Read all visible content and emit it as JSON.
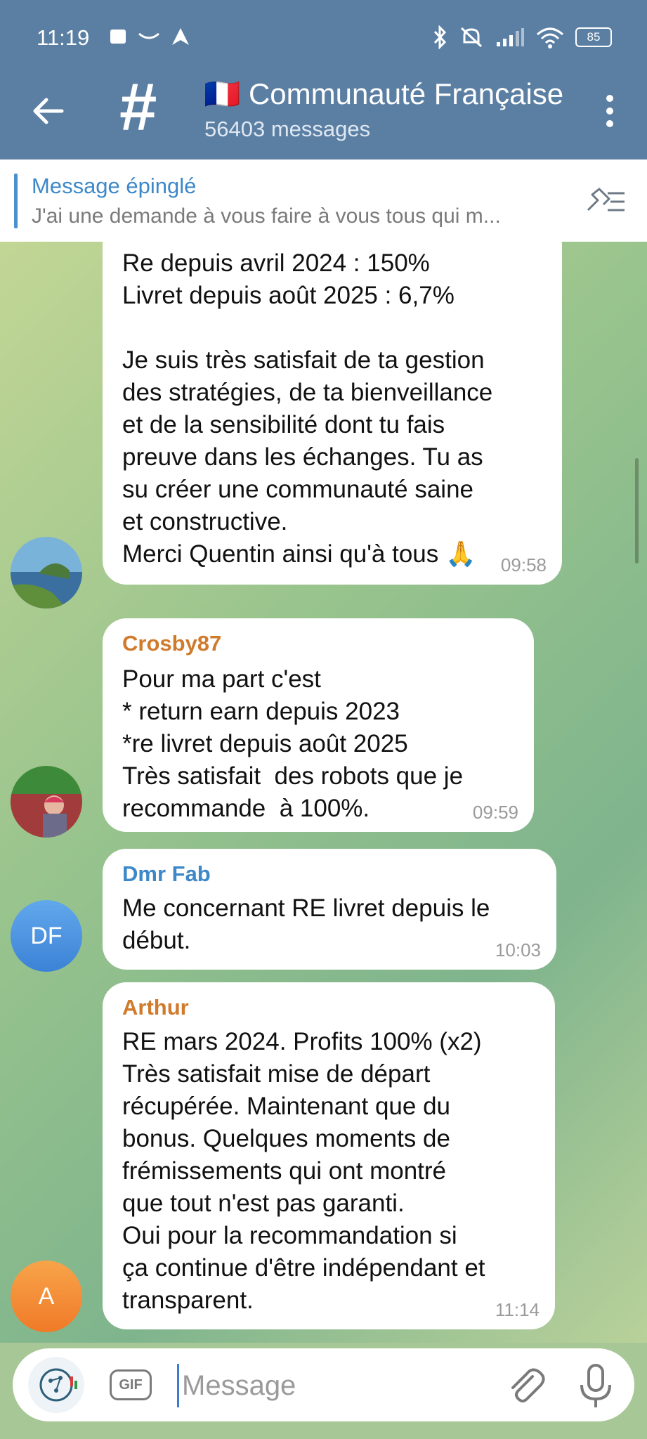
{
  "status": {
    "time": "11:19",
    "battery": "85"
  },
  "header": {
    "flag": "🇫🇷",
    "title": "Communauté Françaisе",
    "subtitle": "56403 messages"
  },
  "pinned": {
    "title": "Message épinglé",
    "text": "J'ai une demande à vous faire à vous tous qui m..."
  },
  "messages": [
    {
      "sender": "",
      "text": "Re depuis avril 2024 : 150%\nLivret depuis août 2025 : 6,7%\n\nJe suis très satisfait de ta gestion\ndes stratégies, de ta bienveillance\net de la sensibilité dont tu fais\npreuve dans les échanges. Tu as\nsu créer une communauté saine\net constructive.\nMerci Quentin ainsi qu'à tous 🙏",
      "time": "09:58"
    },
    {
      "sender": "Crosby87",
      "sender_color": "#d07a2c",
      "text": "Pour ma part c'est\n* return earn depuis 2023\n*re livret depuis août 2025\nTrès satisfait  des robots que je\nrecommande  à 100%.",
      "time": "09:59"
    },
    {
      "sender": "Dmr Fab",
      "sender_color": "#3d88c9",
      "avatar_initials": "DF",
      "text": "Me concernant RE livret depuis le\ndébut.",
      "time": "10:03"
    },
    {
      "sender": "Arthur",
      "sender_color": "#d07a2c",
      "avatar_initials": "A",
      "text": "RE mars 2024. Profits 100% (x2)\nTrès satisfait mise de départ\nrécupérée. Maintenant que du\nbonus. Quelques moments de\nfrémissements qui ont montré\nque tout n'est pas garanti.\nOui pour la recommandation si\nça continue d'être indépendant et\ntransparent.",
      "time": "11:14"
    }
  ],
  "composer": {
    "gif_label": "GIF",
    "placeholder": "Message"
  },
  "colors": {
    "header_bg": "#5b7fa3",
    "link_blue": "#3d88c9",
    "orange_name": "#d07a2c"
  }
}
